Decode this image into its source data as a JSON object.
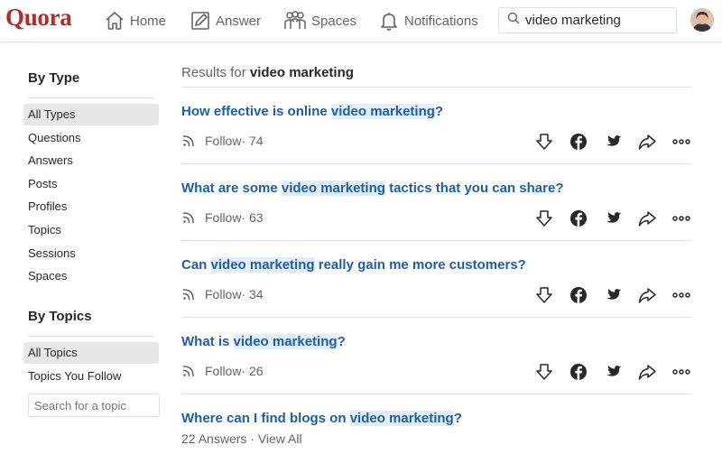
{
  "header": {
    "logo": "Quora",
    "nav": [
      {
        "label": "Home",
        "icon": "home-icon"
      },
      {
        "label": "Answer",
        "icon": "pencil-icon"
      },
      {
        "label": "Spaces",
        "icon": "spaces-icon"
      },
      {
        "label": "Notifications",
        "icon": "bell-icon"
      }
    ],
    "search_value": "video marketing"
  },
  "sidebar": {
    "by_type_heading": "By Type",
    "type_items": [
      "All Types",
      "Questions",
      "Answers",
      "Posts",
      "Profiles",
      "Topics",
      "Sessions",
      "Spaces"
    ],
    "by_topics_heading": "By Topics",
    "topic_items": [
      "All Topics",
      "Topics You Follow"
    ],
    "topic_search_placeholder": "Search for a topic"
  },
  "main": {
    "results_prefix": "Results for",
    "results_query": "video marketing",
    "results": [
      {
        "pre": "How effective is online ",
        "hl": "video marketing",
        "post": "?",
        "follow": "Follow",
        "count": " · 74"
      },
      {
        "pre": "What are some ",
        "hl": "video marketing",
        "post": " tactics that you can share?",
        "follow": "Follow",
        "count": " · 63"
      },
      {
        "pre": "Can ",
        "hl": "video marketing",
        "post": " really gain me more customers?",
        "follow": "Follow",
        "count": " · 34"
      },
      {
        "pre": "What is ",
        "hl": "video marketing",
        "post": "?",
        "follow": "Follow",
        "count": " · 26"
      }
    ],
    "last_result": {
      "pre": "Where can I find blogs on ",
      "hl": "video marketing",
      "post": "?",
      "sub": "22 Answers · View All"
    }
  },
  "colors": {
    "brand": "#b92b27",
    "link": "#195faa",
    "highlight": "#e3ecf8",
    "muted": "#636466"
  }
}
